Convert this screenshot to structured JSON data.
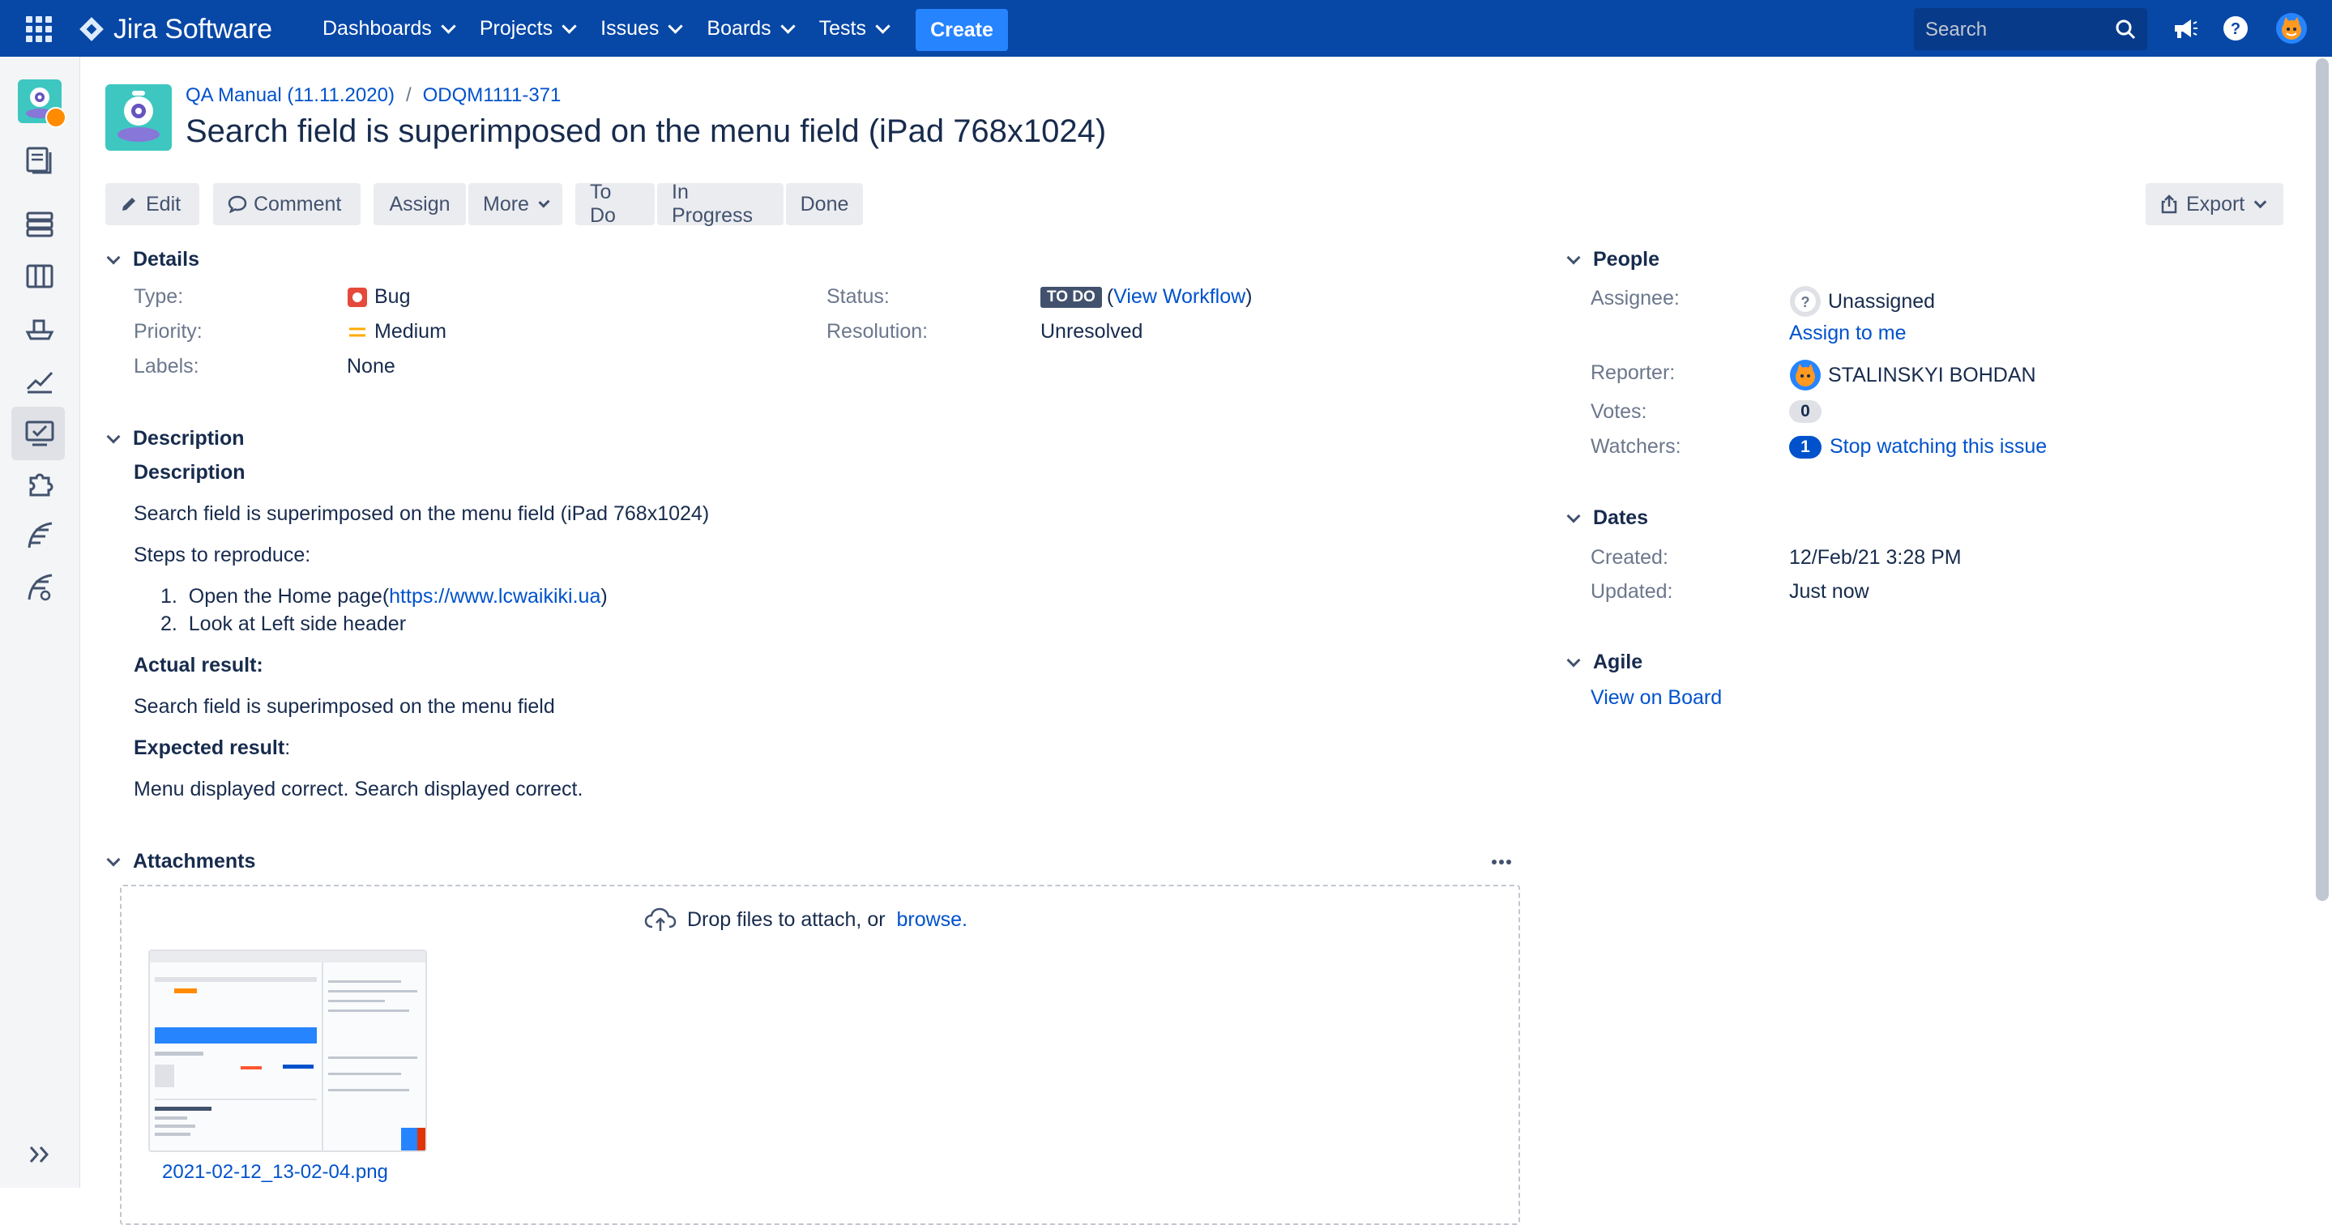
{
  "topbar": {
    "logo_text": "Jira Software",
    "nav": [
      {
        "label": "Dashboards"
      },
      {
        "label": "Projects"
      },
      {
        "label": "Issues"
      },
      {
        "label": "Boards"
      },
      {
        "label": "Tests"
      }
    ],
    "create_label": "Create",
    "search_placeholder": "Search",
    "icons": [
      "app-switcher-icon",
      "jira-logo-icon",
      "search-icon",
      "notifications-megaphone-icon",
      "help-icon",
      "user-avatar-icon"
    ],
    "colors": {
      "bar": "#0747a6",
      "create": "#2684ff"
    }
  },
  "sidebar": {
    "icons": [
      "project-avatar-icon",
      "backlog-icon",
      "releases-icon",
      "board-icon",
      "ship-icon",
      "reports-icon",
      "tests-icon",
      "add-ons-icon",
      "feather-icon",
      "feather-search-icon",
      "expand-icon"
    ],
    "active": "tests-icon"
  },
  "header": {
    "breadcrumb_project": "QA Manual (11.11.2020)",
    "breadcrumb_sep": "/",
    "breadcrumb_key": "ODQM1111-371",
    "title": "Search field is superimposed on the menu field (iPad 768x1024)"
  },
  "toolbar": {
    "edit": "Edit",
    "comment": "Comment",
    "assign": "Assign",
    "more": "More",
    "todo": "To Do",
    "in_progress": "In Progress",
    "done": "Done",
    "export": "Export"
  },
  "details": {
    "heading": "Details",
    "type_label": "Type:",
    "type_value": "Bug",
    "priority_label": "Priority:",
    "priority_value": "Medium",
    "labels_label": "Labels:",
    "labels_value": "None",
    "status_label": "Status:",
    "status_value": "TO DO",
    "status_open": "(",
    "workflow_link": "View Workflow",
    "status_close": ")",
    "resolution_label": "Resolution:",
    "resolution_value": "Unresolved",
    "colors": {
      "bug": "#e5493a",
      "medium": "#ffab00",
      "status": "#42526e"
    }
  },
  "description": {
    "heading": "Description",
    "subheading": "Description",
    "line1": "Search field is superimposed on the menu field (iPad 768x1024)",
    "steps_label": "Steps to reproduce:",
    "step1_num": "1.",
    "step1_text": "Open the Home page(",
    "step1_link": "https://www.lcwaikiki.ua",
    "step1_close": ")",
    "step2_num": "2.",
    "step2_text": "Look at Left side header",
    "actual_label": "Actual result:",
    "actual_text": "Search field is superimposed on the menu field",
    "expected_label": "Expected result",
    "expected_colon": ":",
    "expected_text": "Menu displayed correct. Search displayed correct."
  },
  "attachments": {
    "heading": "Attachments",
    "drop_text": "Drop files to attach, or",
    "browse": "browse.",
    "file_name": "2021-02-12_13-02-04.png"
  },
  "people": {
    "heading": "People",
    "assignee_label": "Assignee:",
    "assignee_value": "Unassigned",
    "assign_to_me": "Assign to me",
    "reporter_label": "Reporter:",
    "reporter_value": "STALINSKYI BOHDAN",
    "votes_label": "Votes:",
    "votes_count": "0",
    "watchers_label": "Watchers:",
    "watchers_count": "1",
    "watch_link": "Stop watching this issue"
  },
  "dates": {
    "heading": "Dates",
    "created_label": "Created:",
    "created_value": "12/Feb/21 3:28 PM",
    "updated_label": "Updated:",
    "updated_value": "Just now"
  },
  "agile": {
    "heading": "Agile",
    "board_link": "View on Board"
  }
}
